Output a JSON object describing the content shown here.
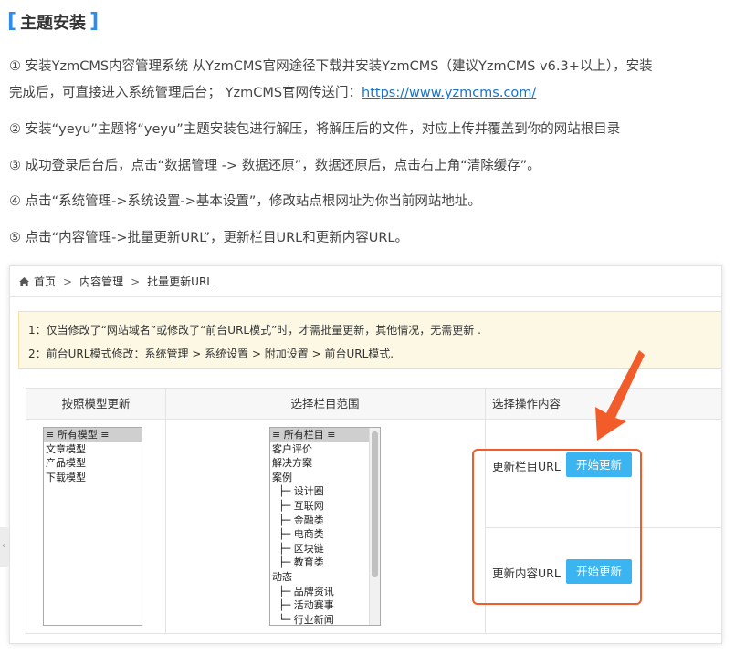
{
  "section": {
    "bracket_left": "[",
    "title": "主题安装",
    "bracket_right": "]"
  },
  "steps": [
    {
      "line1": "① 安装YzmCMS内容管理系统 从YzmCMS官网途径下载并安装YzmCMS（建议YzmCMS v6.3+以上），安装",
      "line2_prefix": "完成后，可直接进入系统管理后台；  YzmCMS官网传送门：",
      "link": "https://www.yzmcms.com/"
    },
    {
      "text": "② 安装“yeyu”主题将“yeyu”主题安装包进行解压，将解压后的文件，对应上传并覆盖到你的网站根目录"
    },
    {
      "text": "③ 成功登录后台后，点击“数据管理 -> 数据还原”，数据还原后，点击右上角“清除缓存”。"
    },
    {
      "text": "④ 点击“系统管理->系统设置->基本设置”，修改站点根网址为你当前网站地址。"
    },
    {
      "text": "⑤ 点击“内容管理->批量更新URL”，更新栏目URL和更新内容URL。"
    }
  ],
  "screenshot": {
    "breadcrumb": {
      "home": "首页",
      "sep": ">",
      "section": "内容管理",
      "page": "批量更新URL"
    },
    "notice": [
      "1：仅当修改了“网站域名”或修改了“前台URL模式”时，才需批量更新，其他情况，无需更新 .",
      "2：前台URL模式修改：系统管理 > 系统设置 > 附加设置 > 前台URL模式."
    ],
    "columns": [
      "按照模型更新",
      "选择栏目范围",
      "选择操作内容"
    ],
    "models": [
      "≡ 所有模型 ≡",
      "文章模型",
      "产品模型",
      "下载模型"
    ],
    "categories": [
      "≡ 所有栏目 ≡",
      "客户评价",
      "解决方案",
      "案例",
      "  ├─ 设计圈",
      "  ├─ 互联网",
      "  ├─ 金融类",
      "  ├─ 电商类",
      "  ├─ 区块链",
      "  ├─ 教育类",
      "动态",
      "  ├─ 品牌资讯",
      "  ├─ 活动赛事",
      "  └─ 行业新闻"
    ],
    "actions": [
      {
        "label": "更新栏目URL",
        "button": "开始更新"
      },
      {
        "label": "更新内容URL",
        "button": "开始更新"
      }
    ],
    "side_tab": "‹"
  },
  "colors": {
    "accent": "#2d8cf0",
    "button": "#3bb4f2",
    "highlight": "#f25c2a",
    "notice_bg": "#fcf8e3"
  }
}
